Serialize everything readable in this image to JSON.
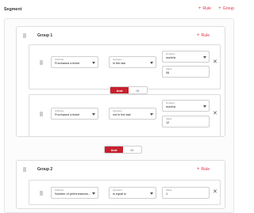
{
  "header": {
    "title": "Segment",
    "add_rule": "Rule",
    "add_group": "Group"
  },
  "groups": [
    {
      "title": "Group 1",
      "add_rule": "Rule",
      "rules": [
        {
          "attribute": {
            "label": "Attribute",
            "value": "Purchased a ticket"
          },
          "operator": {
            "label": "Operator",
            "value": "in the last"
          },
          "duration": {
            "label": "Duration",
            "value": "months"
          },
          "value": {
            "label": "Value",
            "value": "06"
          }
        },
        {
          "attribute": {
            "label": "Attribute",
            "value": "Purchased a ticket"
          },
          "operator": {
            "label": "Operator",
            "value": "not in the last"
          },
          "duration": {
            "label": "Duration",
            "value": "months"
          },
          "value": {
            "label": "Value",
            "value": "12"
          }
        }
      ],
      "combinator": {
        "and": "And",
        "or": "Or",
        "selected": "And"
      }
    },
    {
      "title": "Group 2",
      "add_rule": "Rule",
      "rules": [
        {
          "attribute": {
            "label": "Attribute",
            "value": "Number of performances..."
          },
          "operator": {
            "label": "Operator",
            "value": "is equal to"
          },
          "value": {
            "label": "Value",
            "value": "1"
          }
        }
      ]
    }
  ],
  "group_combinator": {
    "and": "And",
    "or": "Or",
    "selected": "And"
  },
  "colors": {
    "accent": "#d93a47",
    "toggle_active": "#c8202e"
  }
}
